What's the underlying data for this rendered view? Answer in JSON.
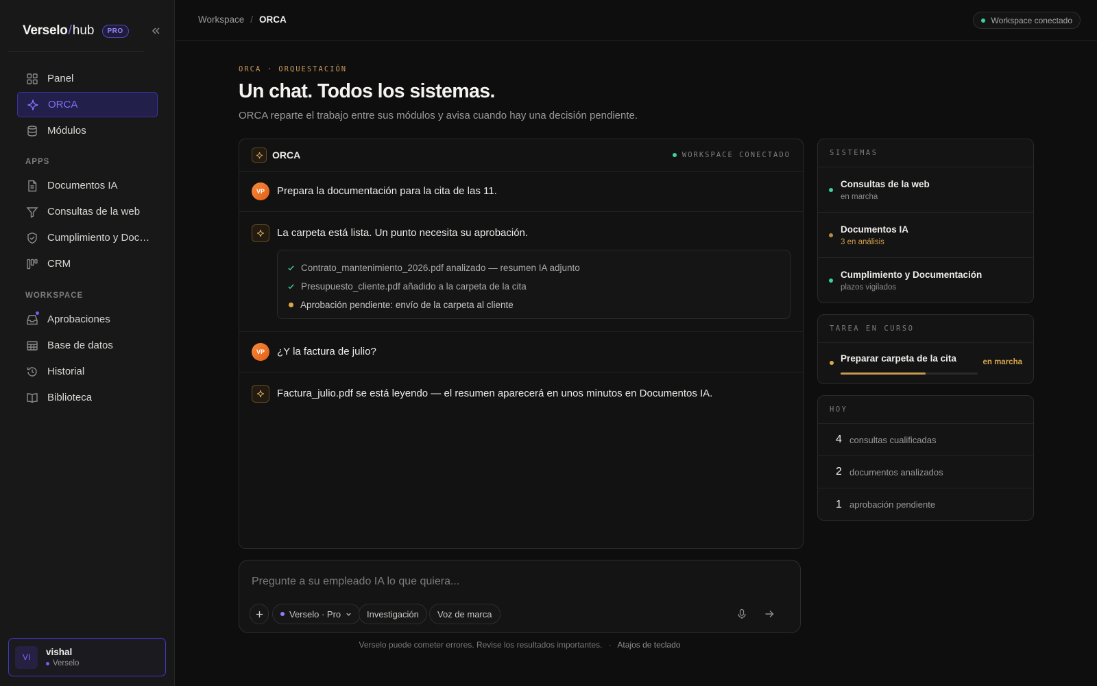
{
  "sidebar": {
    "brand": {
      "part1": "Verselo",
      "slash": "/",
      "part2": "hub",
      "badge": "PRO"
    },
    "main_items": [
      {
        "label": "Panel",
        "icon": "grid-icon"
      },
      {
        "label": "ORCA",
        "icon": "sparkle-icon",
        "active": true
      },
      {
        "label": "Módulos",
        "icon": "database-icon"
      }
    ],
    "apps_heading": "APPS",
    "apps": [
      {
        "label": "Documentos IA",
        "icon": "document-icon"
      },
      {
        "label": "Consultas de la web",
        "icon": "filter-icon"
      },
      {
        "label": "Cumplimiento y Documentación",
        "icon": "shield-check-icon"
      },
      {
        "label": "CRM",
        "icon": "kanban-icon"
      }
    ],
    "workspace_heading": "WORKSPACE",
    "workspace": [
      {
        "label": "Aprobaciones",
        "icon": "inbox-icon",
        "notification": true
      },
      {
        "label": "Base de datos",
        "icon": "table-icon"
      },
      {
        "label": "Historial",
        "icon": "history-icon"
      },
      {
        "label": "Biblioteca",
        "icon": "book-icon"
      }
    ],
    "user": {
      "initials": "VI",
      "name": "vishal",
      "org": "Verselo"
    }
  },
  "topbar": {
    "breadcrumb": [
      "Workspace",
      "ORCA"
    ],
    "separator": "/",
    "status": "Workspace conectado"
  },
  "main": {
    "eyebrow": "ORCA · ORQUESTACIÓN",
    "title": "Un chat. Todos los sistemas.",
    "subtitle": "ORCA reparte el trabajo entre sus módulos y avisa cuando hay una decisión pendiente."
  },
  "chat": {
    "title": "ORCA",
    "status": "WORKSPACE CONECTADO",
    "messages": [
      {
        "from": "user",
        "initials": "VP",
        "text": "Prepara la documentación para la cita de las 11."
      },
      {
        "from": "orca",
        "text": "La carpeta está lista. Un punto necesita su aprobación.",
        "checklist": [
          {
            "status": "done",
            "text": "Contrato_mantenimiento_2026.pdf analizado — resumen IA adjunto"
          },
          {
            "status": "done",
            "text": "Presupuesto_cliente.pdf añadido a la carpeta de la cita"
          },
          {
            "status": "pending",
            "text": "Aprobación pendiente: envío de la carpeta al cliente"
          }
        ]
      },
      {
        "from": "user",
        "initials": "VP",
        "text": "¿Y la factura de julio?"
      },
      {
        "from": "orca",
        "text": "Factura_julio.pdf se está leyendo — el resumen aparecerá en unos minutos en Documentos IA."
      }
    ]
  },
  "composer": {
    "placeholder": "Pregunte a su empleado IA lo que quiera...",
    "model": "Verselo · Pro",
    "chips": [
      "Investigación",
      "Voz de marca"
    ],
    "disclaimer": "Verselo puede cometer errores. Revise los resultados importantes.",
    "disclaimer_sep": "·",
    "shortcuts": "Atajos de teclado"
  },
  "systems": {
    "heading": "SISTEMAS",
    "items": [
      {
        "name": "Consultas de la web",
        "status": "en marcha",
        "color": "#3ed399"
      },
      {
        "name": "Documentos IA",
        "status": "3 en análisis",
        "color": "#d9a94a"
      },
      {
        "name": "Cumplimiento y Documentación",
        "status": "plazos vigilados",
        "color": "#3ed399"
      }
    ]
  },
  "task": {
    "heading": "TAREA EN CURSO",
    "name": "Preparar carpeta de la cita",
    "status": "en marcha",
    "progress": 0.62
  },
  "today": {
    "heading": "HOY",
    "items": [
      {
        "count": "4",
        "label": "consultas cualificadas"
      },
      {
        "count": "2",
        "label": "documentos analizados"
      },
      {
        "count": "1",
        "label": "aprobación pendiente"
      }
    ]
  },
  "colors": {
    "accent": "#6d5ff5",
    "gold": "#d9a94a",
    "green": "#3ed399",
    "background": "#0e0e0e"
  }
}
